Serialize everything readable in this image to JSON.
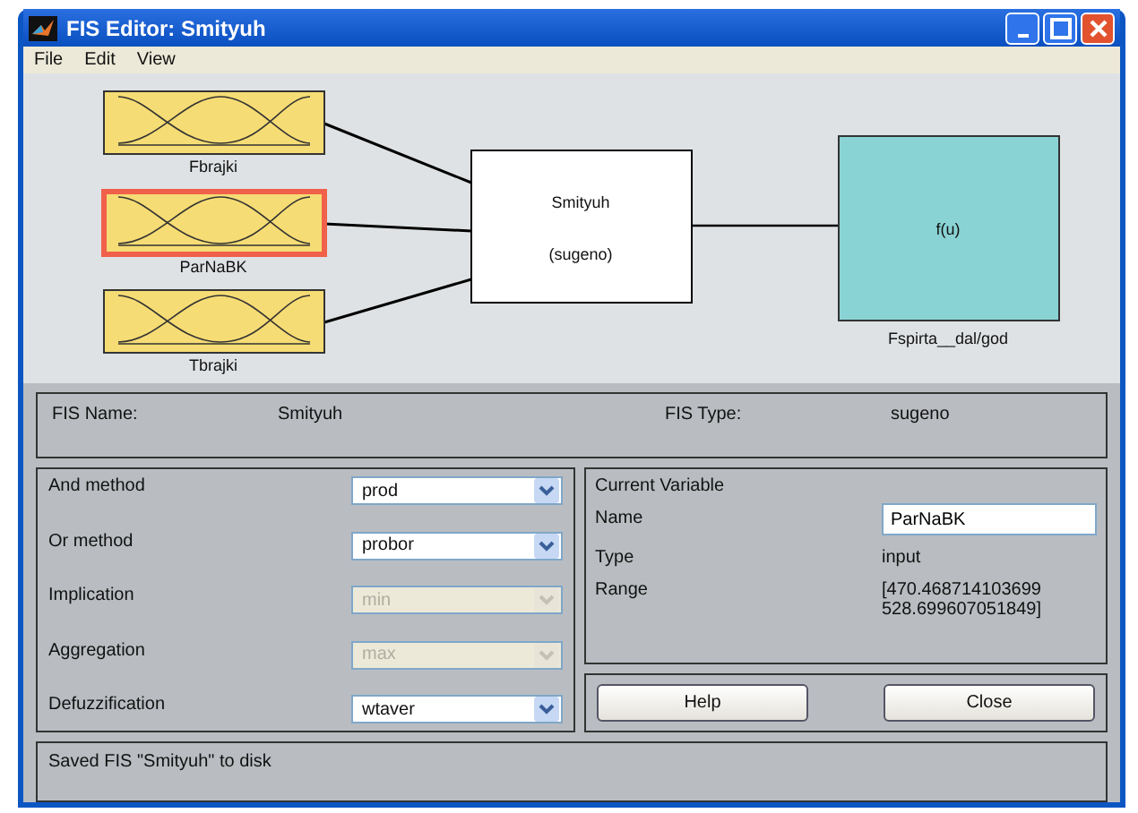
{
  "window": {
    "title": "FIS Editor: Smityuh"
  },
  "menu": [
    "File",
    "Edit",
    "View"
  ],
  "diagram": {
    "inputs": [
      {
        "name": "Fbrajki",
        "selected": false
      },
      {
        "name": "ParNaBK",
        "selected": true
      },
      {
        "name": "Tbrajki",
        "selected": false
      }
    ],
    "system": {
      "name": "Smityuh",
      "type": "(sugeno)"
    },
    "output": {
      "function": "f(u)",
      "name": "Fspirta__dal/god"
    }
  },
  "fis_info": {
    "name_label": "FIS Name:",
    "name": "Smityuh",
    "type_label": "FIS Type:",
    "type": "sugeno"
  },
  "methods": [
    {
      "label": "And method",
      "value": "prod",
      "disabled": false
    },
    {
      "label": "Or method",
      "value": "probor",
      "disabled": false
    },
    {
      "label": "Implication",
      "value": "min",
      "disabled": true
    },
    {
      "label": "Aggregation",
      "value": "max",
      "disabled": true
    },
    {
      "label": "Defuzzification",
      "value": "wtaver",
      "disabled": false
    }
  ],
  "current_variable": {
    "title": "Current Variable",
    "name_label": "Name",
    "name": "ParNaBK",
    "type_label": "Type",
    "type": "input",
    "range_label": "Range",
    "range": [
      "[470.468714103699",
      "528.699607051849]"
    ]
  },
  "buttons": [
    "Help",
    "Close"
  ],
  "status": "Saved FIS \"Smityuh\" to disk"
}
